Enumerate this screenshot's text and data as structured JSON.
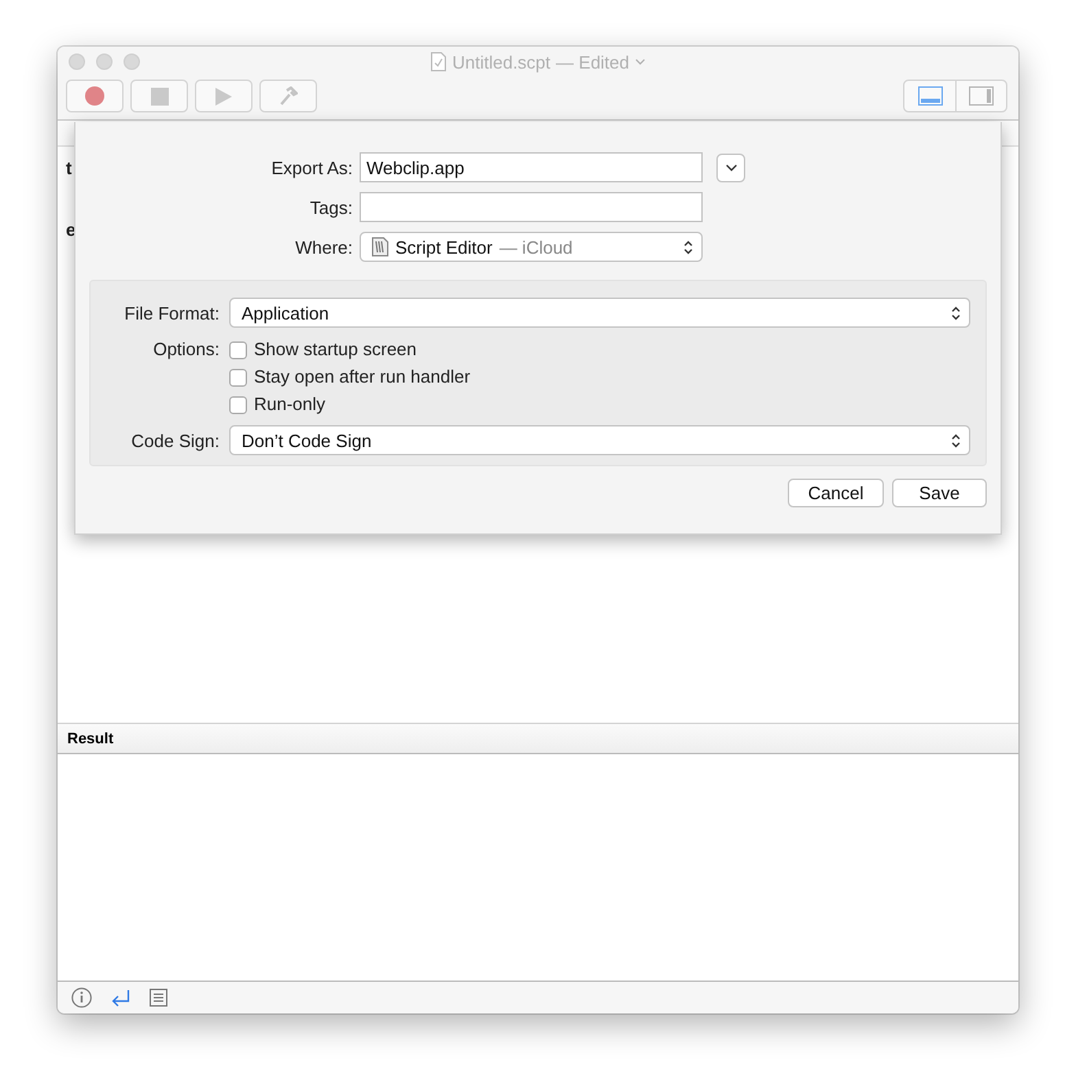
{
  "window": {
    "title": "Untitled.scpt",
    "status": "— Edited"
  },
  "toolbar": {
    "buttons": [
      {
        "kind": "record"
      },
      {
        "kind": "stop"
      },
      {
        "kind": "run"
      },
      {
        "kind": "compile"
      }
    ],
    "view_toggle": [
      {
        "kind": "bottom",
        "selected": true
      },
      {
        "kind": "side",
        "selected": false
      }
    ]
  },
  "editor": {
    "lines": [
      "t",
      "e"
    ]
  },
  "sheet": {
    "export_as": {
      "label": "Export As:",
      "value": "Webclip.app"
    },
    "tags": {
      "label": "Tags:"
    },
    "where": {
      "label": "Where:",
      "value": "Script Editor",
      "location": "— iCloud"
    },
    "file_format": {
      "label": "File Format:",
      "value": "Application"
    },
    "options": {
      "label": "Options:",
      "items": [
        {
          "label": "Show startup screen",
          "checked": false
        },
        {
          "label": "Stay open after run handler",
          "checked": false
        },
        {
          "label": "Run-only",
          "checked": false
        }
      ]
    },
    "code_sign": {
      "label": "Code Sign:",
      "value": "Don’t Code Sign"
    },
    "buttons": [
      "Cancel",
      "Save"
    ]
  },
  "result": {
    "title": "Result"
  },
  "bottom_bar": [
    {
      "kind": "info",
      "selected": false
    },
    {
      "kind": "return",
      "selected": true
    },
    {
      "kind": "list",
      "selected": false
    }
  ]
}
